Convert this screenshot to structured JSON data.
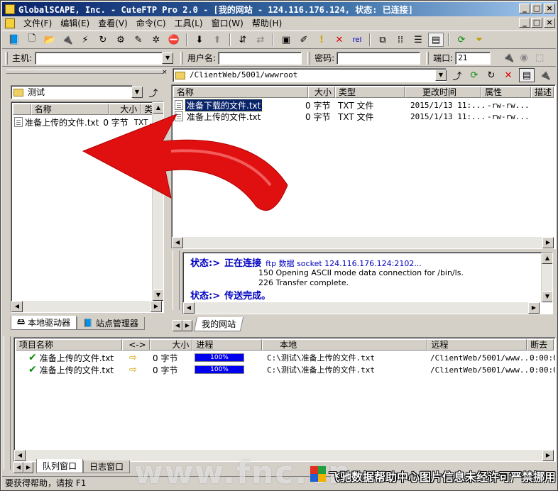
{
  "window": {
    "title": "GlobalSCAPE, Inc. - CuteFTP Pro 2.0 - [我的网站 - 124.116.176.124, 状态: 已连接]"
  },
  "menu": [
    "文件(F)",
    "编辑(E)",
    "查看(V)",
    "命令(C)",
    "工具(L)",
    "窗口(W)",
    "帮助(H)"
  ],
  "connection": {
    "host_label": "主机:",
    "host_value": "",
    "user_label": "用户名:",
    "user_value": "",
    "pass_label": "密码:",
    "pass_value": "",
    "port_label": "端口:",
    "port_value": "21"
  },
  "local": {
    "folder": "测试",
    "columns": [
      "名称",
      "大小",
      "类型"
    ],
    "files": [
      {
        "name": "准备上传的文件.txt",
        "size": "0 字节",
        "type": "TXT..."
      }
    ],
    "tabs": [
      "本地驱动器",
      "站点管理器"
    ]
  },
  "remote": {
    "path": "/ClientWeb/5001/wwwroot",
    "columns": [
      "名称",
      "大小",
      "类型",
      "更改时间",
      "属性",
      "描述"
    ],
    "files": [
      {
        "name": "准备下载的文件.txt",
        "size": "0 字节",
        "type": "TXT 文件",
        "modified": "2015/1/13 11:...",
        "attr": "-rw-rw...",
        "selected": true
      },
      {
        "name": "准备上传的文件.txt",
        "size": "0 字节",
        "type": "TXT 文件",
        "modified": "2015/1/13 11:...",
        "attr": "-rw-rw...",
        "selected": false
      }
    ],
    "tab": "我的网站"
  },
  "log": [
    {
      "prefix": "状态:>",
      "bold": "正在连接",
      "rest": "ftp 数据 socket 124.116.176.124:2102..."
    },
    {
      "text": "150 Opening ASCII mode data connection for /bin/ls."
    },
    {
      "text": "226 Transfer complete."
    },
    {
      "prefix": "状态:>",
      "bold": "传送完成。",
      "rest": ""
    }
  ],
  "queue": {
    "columns": [
      "项目名称",
      "<->",
      "大小",
      "进程",
      "本地",
      "远程",
      "断去"
    ],
    "items": [
      {
        "name": "准备上传的文件.txt",
        "size": "0 字节",
        "progress": 100,
        "progress_label": "100%",
        "local": "C:\\测试\\准备上传的文件.txt",
        "remote": "/ClientWeb/5001/www...",
        "time": "0:00:0"
      },
      {
        "name": "准备上传的文件.txt",
        "size": "0 字节",
        "progress": 100,
        "progress_label": "100%",
        "local": "C:\\测试\\准备上传的文件.txt",
        "remote": "/ClientWeb/5001/www...",
        "time": "0:00:0"
      }
    ],
    "tabs": [
      "队列窗口",
      "日志窗口"
    ]
  },
  "statusbar": "要获得帮助，请按 F1",
  "watermark": {
    "site": "www.fnc.cn",
    "notice": "飞驰数据帮助中心图片信息未经许可严禁挪用"
  },
  "colors": {
    "titlebar": "#0a246a",
    "selection": "#0a246a",
    "progress": "#0000ee",
    "arrow": "#e01010"
  }
}
